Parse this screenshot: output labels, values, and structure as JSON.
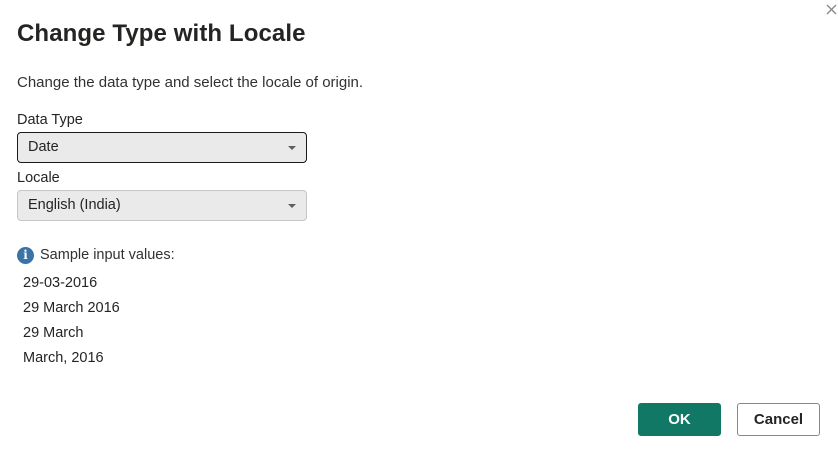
{
  "dialog": {
    "title": "Change Type with Locale",
    "description": "Change the data type and select the locale of origin.",
    "close_icon": "close-icon"
  },
  "data_type": {
    "label": "Data Type",
    "value": "Date"
  },
  "locale": {
    "label": "Locale",
    "value": "English (India)"
  },
  "samples": {
    "icon": "info-icon",
    "label": "Sample input values:",
    "values": [
      "29-03-2016",
      "29 March 2016",
      "29 March",
      "March, 2016"
    ]
  },
  "buttons": {
    "ok_label": "OK",
    "cancel_label": "Cancel"
  },
  "colors": {
    "primary": "#117865",
    "info": "#3a73a8"
  }
}
